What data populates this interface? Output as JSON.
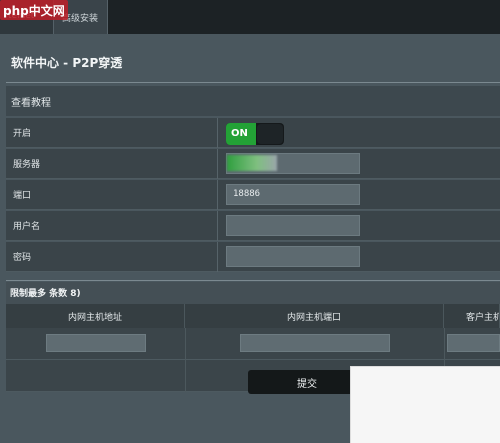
{
  "tabs": [
    {
      "label": "telnet"
    },
    {
      "label": "高级安装"
    }
  ],
  "watermark": {
    "text": "php中文网"
  },
  "page": {
    "title": "软件中心 - P2P穿透",
    "section": "查看教程"
  },
  "form": {
    "enable_label": "开启",
    "toggle_state": "ON",
    "server_label": "服务器",
    "server_value": "",
    "port_label": "端口",
    "port_value": "18886",
    "username_label": "用户名",
    "username_value": "",
    "password_label": "密码",
    "password_value": ""
  },
  "mapping": {
    "title": "限制最多 条数 8)",
    "columns": [
      "内网主机地址",
      "内网主机端口",
      "客户主机"
    ]
  },
  "submit_label": "提交",
  "colors": {
    "panel": "#4a575e",
    "toggle_on": "#23a236",
    "topbar": "#1c2225"
  }
}
